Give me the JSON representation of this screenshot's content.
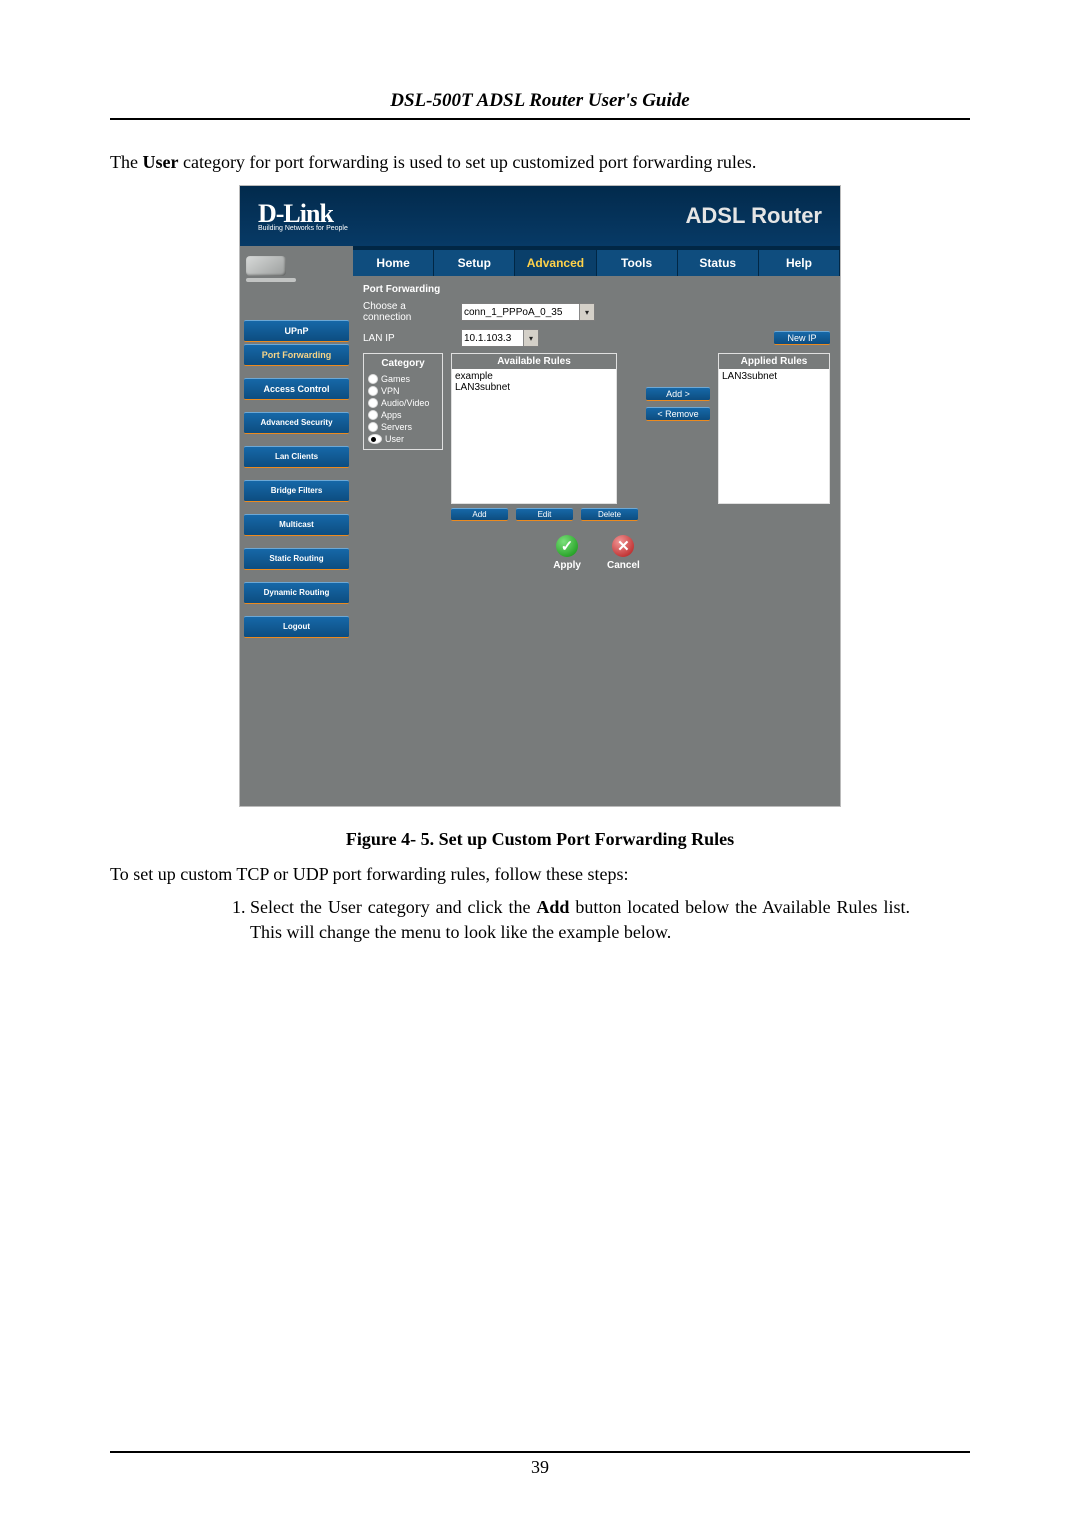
{
  "doc": {
    "header": "DSL-500T ADSL Router User's Guide",
    "intro_pre": "The ",
    "intro_bold": "User",
    "intro_post": " category for port forwarding is used to set up customized port forwarding rules.",
    "caption": "Figure 4- 5. Set up Custom Port Forwarding Rules",
    "steps_intro": "To set up custom TCP or UDP port forwarding rules, follow these steps:",
    "step1_a": "Select the User category and click the ",
    "step1_bold": "Add",
    "step1_b": " button located below the Available Rules list. This will change the menu to look like the example below.",
    "page_number": "39"
  },
  "router": {
    "brand": "D-Link",
    "brand_sub": "Building Networks for People",
    "title": "ADSL Router",
    "tabs": [
      "Home",
      "Setup",
      "Advanced",
      "Tools",
      "Status",
      "Help"
    ],
    "active_tab": "Advanced",
    "sidebar": [
      "UPnP",
      "Port Forwarding",
      "Access Control",
      "Advanced Security",
      "Lan Clients",
      "Bridge Filters",
      "Multicast",
      "Static Routing",
      "Dynamic Routing",
      "Logout"
    ],
    "section_title": "Port Forwarding",
    "conn_label": "Choose a connection",
    "conn_value": "conn_1_PPPoA_0_35",
    "lanip_label": "LAN IP",
    "lanip_value": "10.1.103.3",
    "newip_btn": "New IP",
    "headers": {
      "category": "Category",
      "available": "Available Rules",
      "applied": "Applied Rules"
    },
    "categories": [
      "Games",
      "VPN",
      "Audio/Video",
      "Apps",
      "Servers",
      "User"
    ],
    "selected_category": "User",
    "available_rules": [
      "example",
      "LAN3subnet"
    ],
    "applied_rules": [
      "LAN3subnet"
    ],
    "xfer": {
      "add": "Add >",
      "remove": "< Remove"
    },
    "rule_btns": {
      "add": "Add",
      "edit": "Edit",
      "delete": "Delete"
    },
    "apply": "Apply",
    "cancel": "Cancel"
  }
}
